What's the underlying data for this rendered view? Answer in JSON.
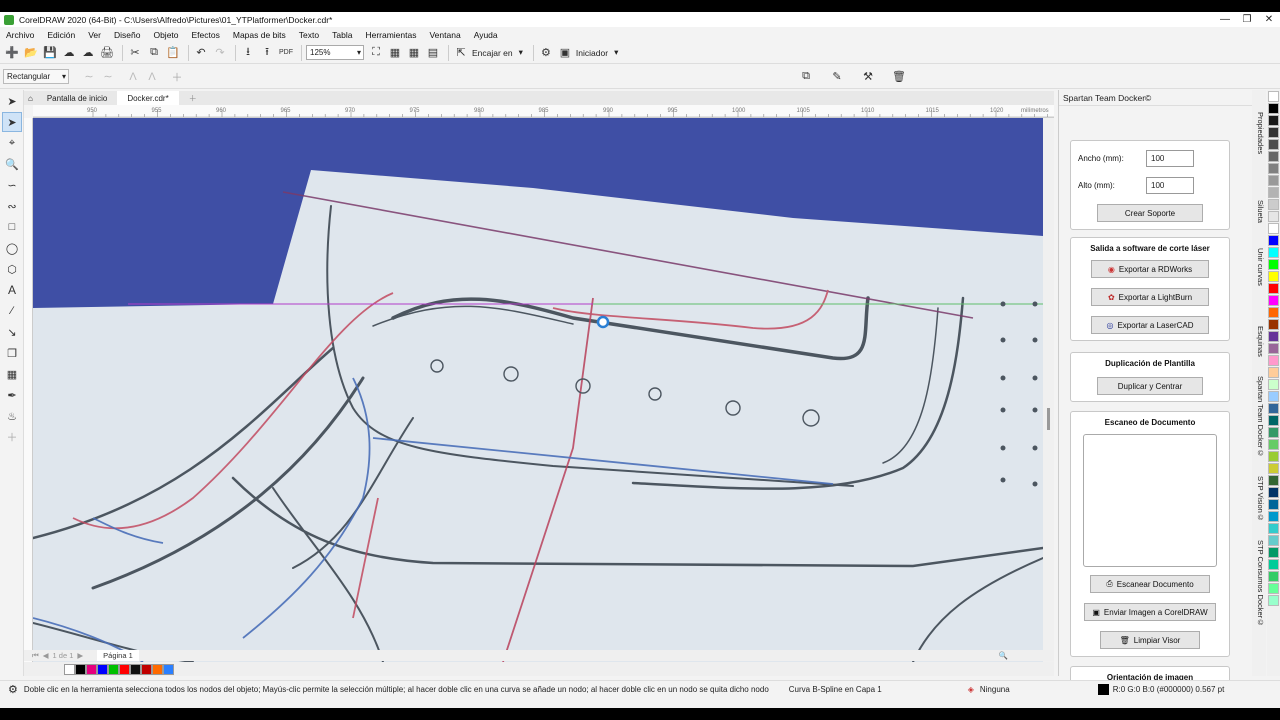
{
  "window": {
    "title": "CorelDRAW 2020 (64-Bit) - C:\\Users\\Alfredo\\Pictures\\01_YTPlatformer\\Docker.cdr*",
    "minimize_icon": "minimize-icon",
    "restore_icon": "restore-icon",
    "close_icon": "close-icon"
  },
  "menu": [
    "Archivo",
    "Edición",
    "Ver",
    "Diseño",
    "Objeto",
    "Efectos",
    "Mapas de bits",
    "Texto",
    "Tabla",
    "Herramientas",
    "Ventana",
    "Ayuda"
  ],
  "toolbar": {
    "zoom": "125%",
    "snap_label": "Encajar en",
    "launcher_label": "Iniciador"
  },
  "property_bar": {
    "shape_mode": "Rectangular"
  },
  "doc_tabs": [
    "Pantalla de inicio",
    "Docker.cdr*"
  ],
  "ruler_ticks": [
    "950",
    "955",
    "960",
    "965",
    "970",
    "975",
    "980",
    "985",
    "990",
    "995",
    "1000",
    "1005",
    "1010",
    "1015",
    "1020"
  ],
  "ruler_unit": "milímetros",
  "page_nav": {
    "page_count": "1 de 1",
    "page_tab": "Página 1"
  },
  "docker": {
    "title": "Spartan Team Docker©",
    "support": {
      "width_label": "Ancho (mm):",
      "width_value": "100",
      "height_label": "Alto (mm):",
      "height_value": "100",
      "create_button": "Crear Soporte"
    },
    "laser": {
      "heading": "Salida a software de corte láser",
      "rdworks": "Exportar a RDWorks",
      "lightburn": "Exportar a LightBurn",
      "lasercad": "Exportar a LaserCAD"
    },
    "template": {
      "heading": "Duplicación de Plantilla",
      "button": "Duplicar y Centrar"
    },
    "scan": {
      "heading": "Escaneo de Documento",
      "scan_button": "Escanear Documento",
      "send_button": "Enviar Imagen a CorelDRAW",
      "clear_button": "Limpiar Visor"
    },
    "orientation": {
      "heading": "Orientación de imagen"
    }
  },
  "side_tabs": [
    "Propiedades",
    "Silueta",
    "Unir curvas",
    "Esquinas",
    "Spartan Team Docker©",
    "STP Vision©",
    "STP Consumos Docker©"
  ],
  "status": {
    "hint": "Doble clic en la herramienta selecciona todos los nodos del objeto; Mayús-clic permite la selección múltiple; al hacer doble clic en una curva se añade un nodo; al hacer doble clic en un nodo se quita dicho nodo",
    "object": "Curva B-Spline en Capa 1",
    "fill": "Ninguna",
    "outline": "R:0 G:0 B:0 (#000000)  0.567 pt"
  },
  "colors": {
    "canvas_bg": "#3f4fa5",
    "paper": "#dfe6ed",
    "palette": [
      "#ffffff",
      "#000000",
      "#e5007e",
      "#0000ff",
      "#00c000",
      "#ff0000",
      "#101010",
      "#c00000",
      "#ff6a00",
      "#2a7fff"
    ]
  }
}
